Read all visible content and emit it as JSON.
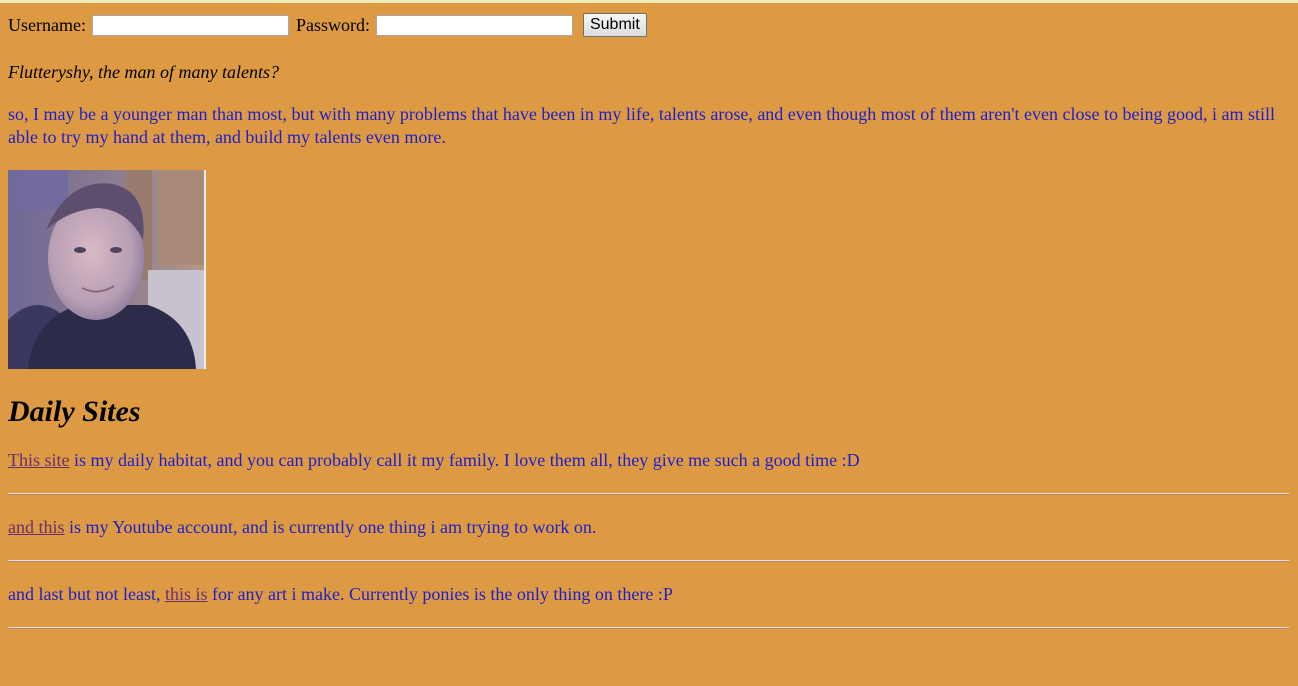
{
  "login": {
    "username_label": "Username:",
    "username_value": "",
    "password_label": "Password:",
    "password_value": "",
    "submit_label": "Submit"
  },
  "tagline": "Flutteryshy, the man of many talents?",
  "intro": "so, I may be a younger man than most, but with many problems that have been in my life, talents arose, and even though most of them aren't even close to being good, i am still able to try my hand at them, and build my talents even more.",
  "photo": {
    "icon": "profile-photo"
  },
  "daily_sites": {
    "heading": "Daily Sites",
    "rows": [
      {
        "before": "",
        "link": "This site",
        "after": " is my daily habitat, and you can probably call it my family. I love them all, they give me such a good time :D"
      },
      {
        "before": "",
        "link": "and this",
        "after": " is my Youtube account, and is currently one thing i am trying to work on."
      },
      {
        "before": "and last but not least, ",
        "link": "this is",
        "after": " for any art i make. Currently ponies is the only thing on there :P"
      }
    ]
  },
  "colors": {
    "background": "#dd9a43",
    "text_blue": "#1e1ecc",
    "link": "#6a2f6f"
  }
}
